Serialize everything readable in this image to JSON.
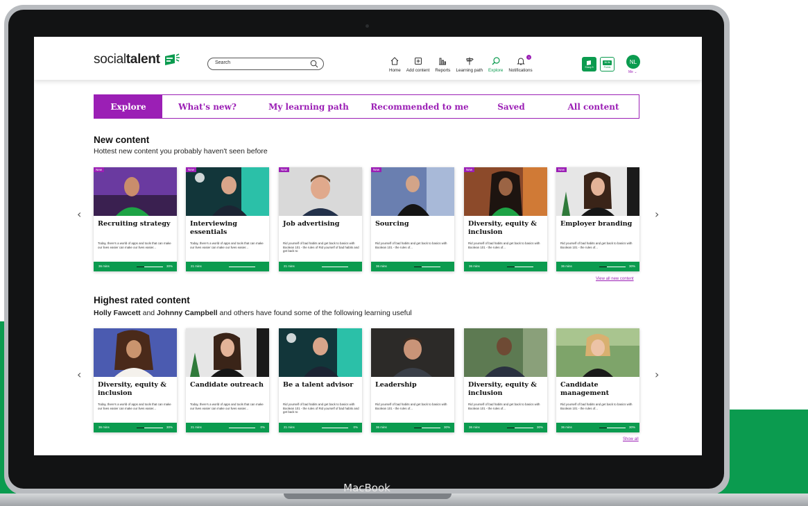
{
  "brand": {
    "logo_prefix": "social",
    "logo_bold": "talent",
    "green": "#0b9b4f",
    "purple": "#9b1fb5"
  },
  "device_label": "MacBook",
  "search": {
    "placeholder": "Search"
  },
  "nav": [
    {
      "label": "Home",
      "icon": "home-icon"
    },
    {
      "label": "Add content",
      "icon": "add-content-icon"
    },
    {
      "label": "Reports",
      "icon": "reports-icon"
    },
    {
      "label": "Learning path",
      "icon": "signpost-icon"
    },
    {
      "label": "Explore",
      "icon": "explore-icon",
      "active": true
    },
    {
      "label": "Notifications",
      "icon": "bell-icon",
      "count": "1"
    }
  ],
  "badges": {
    "sharp_label": "Sharp 5",
    "points_value": "36.5k",
    "points_label": "Points"
  },
  "user": {
    "initials": "NL",
    "menu_label": "Me ⌄"
  },
  "tabs": [
    "Explore",
    "What's new?",
    "My learning path",
    "Recommended to me",
    "Saved",
    "All content"
  ],
  "new_content": {
    "title": "New content",
    "subtitle": "Hottest new content you probably haven't seen before",
    "view_all": "View all new content",
    "cards": [
      {
        "title": "Recruiting strategy",
        "tag": "New",
        "desc": "Today, there's a world of apps and tools that can make our lives easier can make our lives easier...",
        "duration": "36 mins",
        "progress": 30,
        "progress_label": "30%"
      },
      {
        "title": "Interviewing essentials",
        "tag": "New",
        "desc": "Today, there's a world of apps and tools that can make our lives easier can make our lives easier...",
        "duration": "21 mins",
        "progress": 0,
        "progress_label": ""
      },
      {
        "title": "Job advertising",
        "tag": "New",
        "desc": "Rid yourself of bad habits and get back to basics with Boolean 101 - the rules of Rid yourself of bad habits and get back to",
        "duration": "21 mins",
        "progress": 0,
        "progress_label": ""
      },
      {
        "title": "Sourcing",
        "tag": "New",
        "desc": "Rid yourself of bad habits and get back to basics with Boolean 101 - the rules of...",
        "duration": "36 mins",
        "progress": 30,
        "progress_label": ""
      },
      {
        "title": "Diversity, equity & inclusion",
        "tag": "New",
        "desc": "Rid yourself of bad habits and get back to basics with Boolean 101 - the rules of...",
        "duration": "36 mins",
        "progress": 30,
        "progress_label": ""
      },
      {
        "title": "Employer branding",
        "tag": "New",
        "desc": "Rid yourself of bad habits and get back to basics with Boolean 101 - the rules of...",
        "duration": "36 mins",
        "progress": 30,
        "progress_label": "30%"
      }
    ]
  },
  "highest_rated": {
    "title": "Highest rated content",
    "subtitle_name1": "Holly Fawcett",
    "subtitle_and": " and ",
    "subtitle_name2": "Johnny Campbell",
    "subtitle_rest": " and others have found some of the following learning useful",
    "view_all": "Show all",
    "cards": [
      {
        "title": "Diversity, equity & inclusion",
        "desc": "Today, there's a world of apps and tools that can make our lives easier can make our lives easier...",
        "duration": "36 mins",
        "progress": 30,
        "progress_label": "30%"
      },
      {
        "title": "Candidate outreach",
        "desc": "Today, there's a world of apps and tools that can make our lives easier can make our lives easier...",
        "duration": "21 mins",
        "progress": 0,
        "progress_label": "0%"
      },
      {
        "title": "Be a talent advisor",
        "desc": "Rid yourself of bad habits and get back to basics with Boolean 101 - the rules of Rid yourself of bad habits and get back to",
        "duration": "21 mins",
        "progress": 0,
        "progress_label": "0%"
      },
      {
        "title": "Leadership",
        "desc": "Rid yourself of bad habits and get back to basics with Boolean 101 - the rules of...",
        "duration": "36 mins",
        "progress": 30,
        "progress_label": "30%"
      },
      {
        "title": "Diversity, equity & inclusion",
        "desc": "Rid yourself of bad habits and get back to basics with Boolean 101 - the rules of...",
        "duration": "36 mins",
        "progress": 30,
        "progress_label": "30%"
      },
      {
        "title": "Candidate management",
        "desc": "Rid yourself of bad habits and get back to basics with Boolean 101 - the rules of...",
        "duration": "36 mins",
        "progress": 30,
        "progress_label": "30%"
      }
    ]
  }
}
